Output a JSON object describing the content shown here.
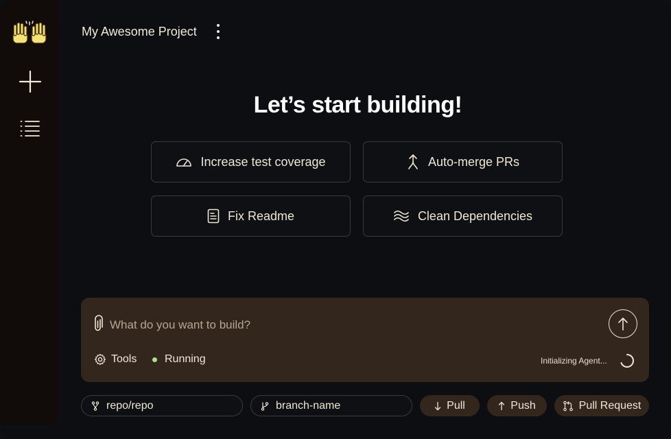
{
  "app": {
    "project_title": "My Awesome Project"
  },
  "sidebar": {
    "items": [
      {
        "icon": "raised-hands-icon"
      },
      {
        "icon": "plus-icon"
      },
      {
        "icon": "list-icon"
      }
    ]
  },
  "main": {
    "heading": "Let’s start building!",
    "suggestions": [
      {
        "label": "Increase test coverage",
        "icon": "gauge-icon"
      },
      {
        "label": "Auto-merge PRs",
        "icon": "merge-arrow-icon"
      },
      {
        "label": "Fix Readme",
        "icon": "document-icon"
      },
      {
        "label": "Clean Dependencies",
        "icon": "waves-icon"
      }
    ]
  },
  "composer": {
    "placeholder": "What do you want to build?",
    "tools_label": "Tools",
    "status_label": "Running",
    "agent_status": "Initializing Agent...",
    "status_color": "#a6e590"
  },
  "bottom_bar": {
    "repo": "repo/repo",
    "branch": "branch-name",
    "pull_label": "Pull",
    "push_label": "Push",
    "pr_label": "Pull Request"
  },
  "colors": {
    "background": "#0d0e11",
    "sidebar": "#110c0a",
    "composer": "#33261d",
    "text": "#f2ead9",
    "logo": "#f6e27a"
  }
}
